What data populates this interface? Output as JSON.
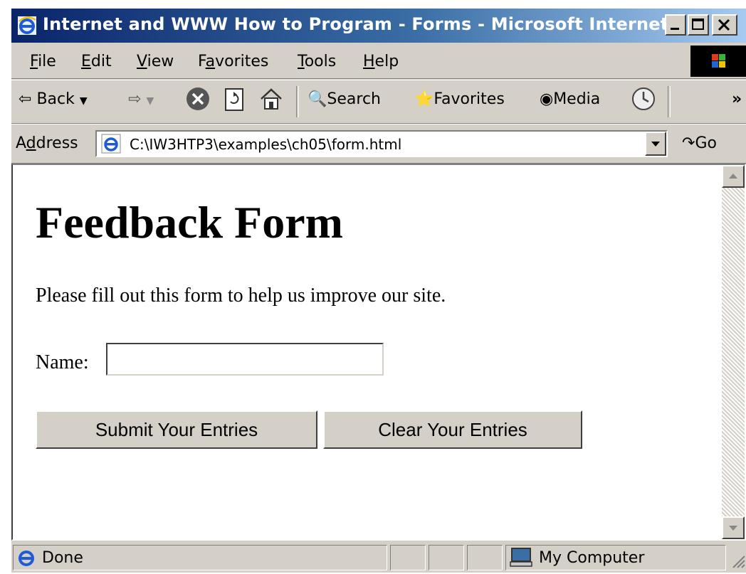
{
  "window": {
    "title": "Internet and WWW How to Program - Forms - Microsoft Internet E..."
  },
  "menu": {
    "items": [
      {
        "label": "File",
        "key": "F",
        "rest": "ile"
      },
      {
        "label": "Edit",
        "key": "E",
        "rest": "dit"
      },
      {
        "label": "View",
        "key": "V",
        "rest": "iew"
      },
      {
        "label": "Favorites",
        "pre": "F",
        "key": "a",
        "rest": "vorites"
      },
      {
        "label": "Tools",
        "key": "T",
        "rest": "ools"
      },
      {
        "label": "Help",
        "key": "H",
        "rest": "elp"
      }
    ]
  },
  "toolbar": {
    "back": "Back",
    "search": "Search",
    "favorites": "Favorites",
    "media": "Media",
    "more": "»"
  },
  "address": {
    "label_pre": "A",
    "label_key": "d",
    "label_rest": "dress",
    "url": "C:\\IW3HTP3\\examples\\ch05\\form.html",
    "go": "Go"
  },
  "page": {
    "heading": "Feedback Form",
    "intro": "Please fill out this form to help us improve our site.",
    "name_label": "Name:",
    "name_value": "",
    "submit_label": "Submit Your Entries",
    "clear_label": "Clear Your Entries"
  },
  "status": {
    "text": "Done",
    "zone": "My Computer"
  }
}
